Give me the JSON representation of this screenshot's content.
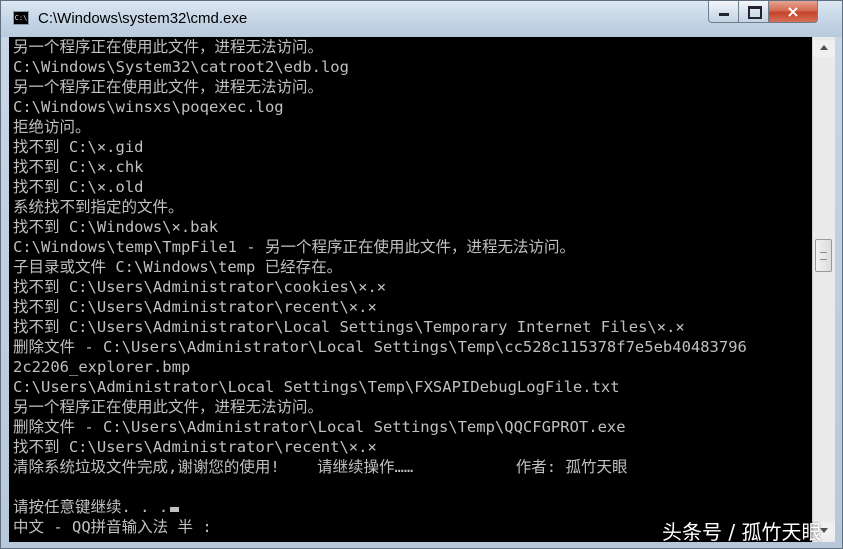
{
  "window": {
    "title": "C:\\Windows\\system32\\cmd.exe",
    "icon_label": "C:\\",
    "controls": {
      "minimize": "minimize-icon",
      "maximize": "maximize-icon",
      "close": "×"
    }
  },
  "console": {
    "lines": [
      "另一个程序正在使用此文件，进程无法访问。",
      "C:\\Windows\\System32\\catroot2\\edb.log",
      "另一个程序正在使用此文件，进程无法访问。",
      "C:\\Windows\\winsxs\\poqexec.log",
      "拒绝访问。",
      "找不到 C:\\×.gid",
      "找不到 C:\\×.chk",
      "找不到 C:\\×.old",
      "系统找不到指定的文件。",
      "找不到 C:\\Windows\\×.bak",
      "C:\\Windows\\temp\\TmpFile1 - 另一个程序正在使用此文件，进程无法访问。",
      "子目录或文件 C:\\Windows\\temp 已经存在。",
      "找不到 C:\\Users\\Administrator\\cookies\\×.×",
      "找不到 C:\\Users\\Administrator\\recent\\×.×",
      "找不到 C:\\Users\\Administrator\\Local Settings\\Temporary Internet Files\\×.×",
      "删除文件 - C:\\Users\\Administrator\\Local Settings\\Temp\\cc528c115378f7e5eb40483796",
      "2c2206_explorer.bmp",
      "C:\\Users\\Administrator\\Local Settings\\Temp\\FXSAPIDebugLogFile.txt",
      "另一个程序正在使用此文件，进程无法访问。",
      "删除文件 - C:\\Users\\Administrator\\Local Settings\\Temp\\QQCFGPROT.exe",
      "找不到 C:\\Users\\Administrator\\recent\\×.×",
      "清除系统垃圾文件完成,谢谢您的使用!    请继续操作……           作者: 孤竹天眼",
      "",
      "请按任意键继续. . .",
      "中文 - QQ拼音输入法 半 :"
    ]
  },
  "watermark": "头条号 / 孤竹天眼",
  "colors": {
    "console_bg": "#000000",
    "console_text": "#c0c0c0",
    "close_button": "#c4432b"
  }
}
